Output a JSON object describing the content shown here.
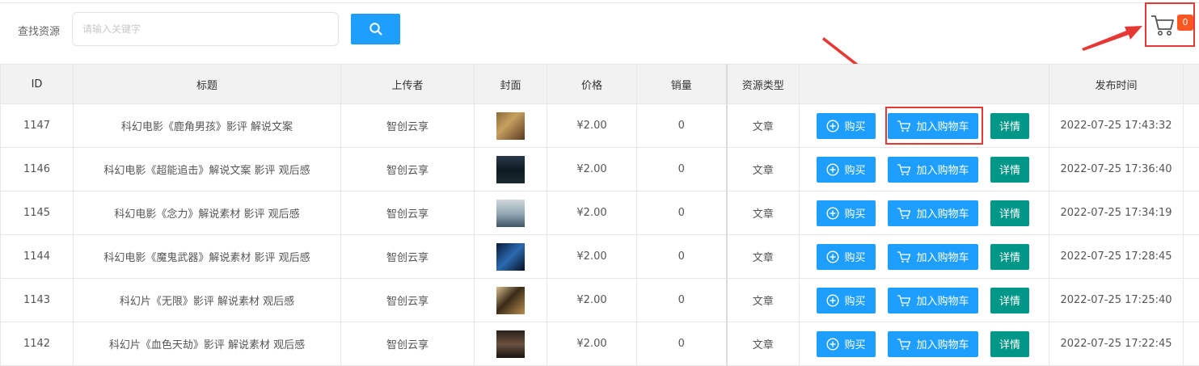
{
  "search": {
    "label": "查找资源",
    "placeholder": "请输入关键字",
    "value": ""
  },
  "cart": {
    "count": "0"
  },
  "table": {
    "headers": [
      "ID",
      "标题",
      "上传者",
      "封面",
      "价格",
      "销量",
      "资源类型",
      "",
      "发布时间"
    ],
    "buy_label": "购买",
    "add_cart_label": "加入购物车",
    "detail_label": "详情",
    "rows": [
      {
        "id": "1147",
        "title": "科幻电影《鹿角男孩》影评 解说文案",
        "uploader": "智创云享",
        "price": "¥2.00",
        "sales": "0",
        "type": "文章",
        "date": "2022-07-25 17:43:32"
      },
      {
        "id": "1146",
        "title": "科幻电影《超能追击》解说文案 影评 观后感",
        "uploader": "智创云享",
        "price": "¥2.00",
        "sales": "0",
        "type": "文章",
        "date": "2022-07-25 17:36:40"
      },
      {
        "id": "1145",
        "title": "科幻电影《念力》解说素材 影评 观后感",
        "uploader": "智创云享",
        "price": "¥2.00",
        "sales": "0",
        "type": "文章",
        "date": "2022-07-25 17:34:19"
      },
      {
        "id": "1144",
        "title": "科幻电影《魔鬼武器》解说素材 影评 观后感",
        "uploader": "智创云享",
        "price": "¥2.00",
        "sales": "0",
        "type": "文章",
        "date": "2022-07-25 17:28:45"
      },
      {
        "id": "1143",
        "title": "科幻片《无限》影评 解说素材 观后感",
        "uploader": "智创云享",
        "price": "¥2.00",
        "sales": "0",
        "type": "文章",
        "date": "2022-07-25 17:25:40"
      },
      {
        "id": "1142",
        "title": "科幻片《血色天劫》影评 解说素材 观后感",
        "uploader": "智创云享",
        "price": "¥2.00",
        "sales": "0",
        "type": "文章",
        "date": "2022-07-25 17:22:45"
      }
    ]
  },
  "colors": {
    "primary": "#1e9fff",
    "detail": "#009688",
    "price": "#ff5722",
    "highlight": "#e53935"
  }
}
